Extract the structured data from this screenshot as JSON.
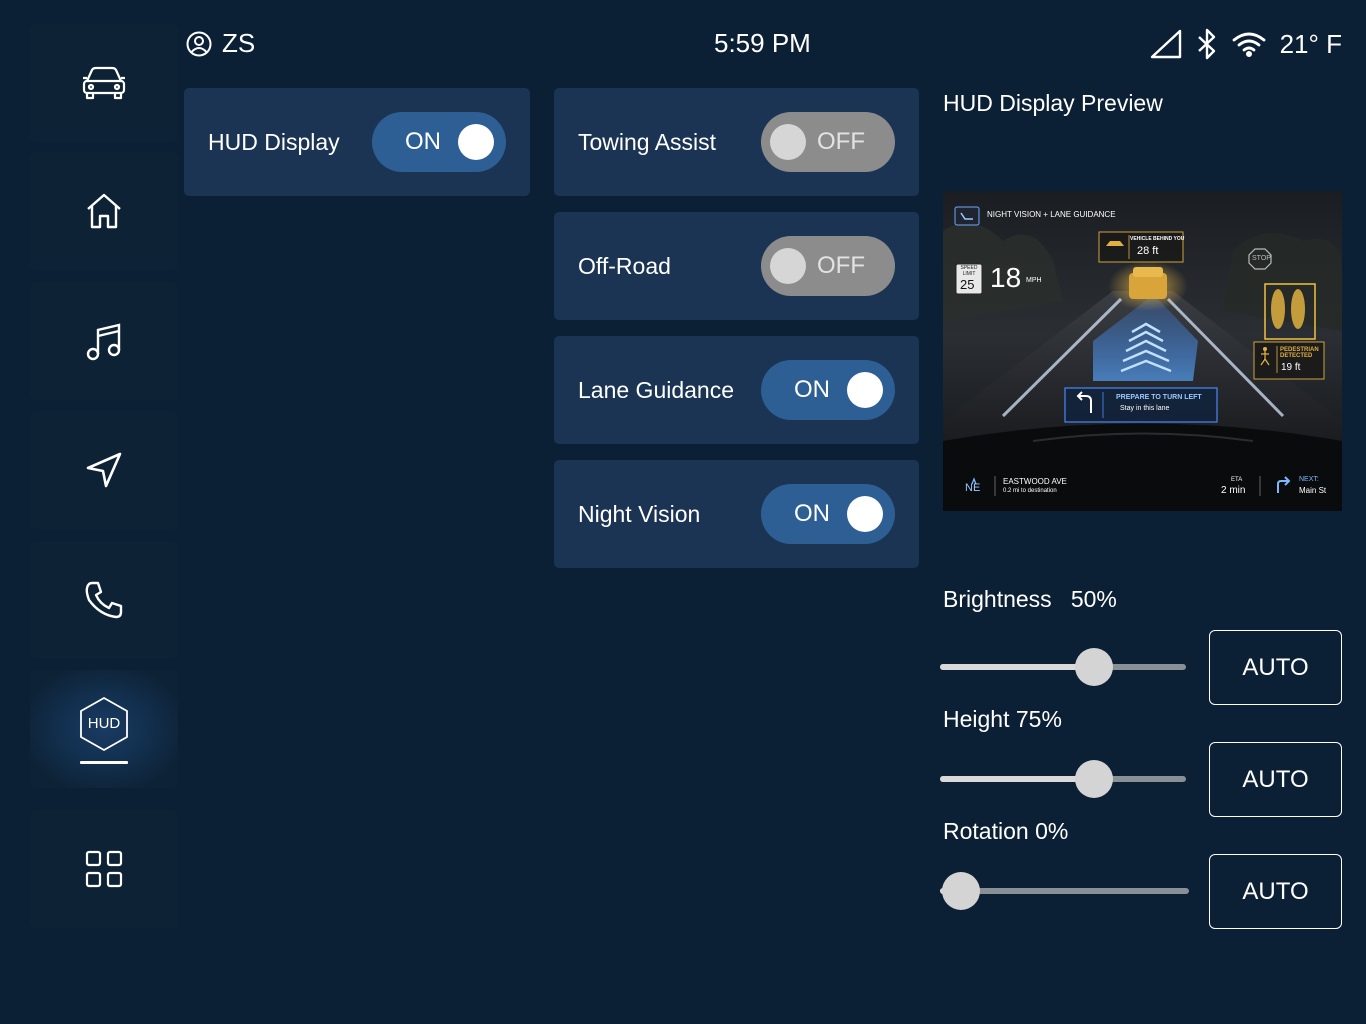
{
  "status_bar": {
    "user_initials": "ZS",
    "time": "5:59 PM",
    "temperature": "21° F"
  },
  "sidebar": {
    "items": [
      {
        "name": "car",
        "icon": "car-icon"
      },
      {
        "name": "home",
        "icon": "home-icon"
      },
      {
        "name": "music",
        "icon": "music-note-icon"
      },
      {
        "name": "navigation",
        "icon": "navigation-arrow-icon"
      },
      {
        "name": "phone",
        "icon": "phone-icon"
      },
      {
        "name": "hud",
        "icon": "hud-hexagon-icon",
        "label": "HUD",
        "active": true
      },
      {
        "name": "apps",
        "icon": "grid-icon"
      }
    ]
  },
  "toggles": {
    "hud_display": {
      "label": "HUD Display",
      "state": "ON"
    },
    "towing_assist": {
      "label": "Towing Assist",
      "state": "OFF"
    },
    "off_road": {
      "label": "Off-Road",
      "state": "OFF"
    },
    "lane_guidance": {
      "label": "Lane Guidance",
      "state": "ON"
    },
    "night_vision": {
      "label": "Night Vision",
      "state": "ON"
    }
  },
  "preview": {
    "title": "HUD Display Preview",
    "mode_label": "NIGHT VISION + LANE GUIDANCE",
    "vehicle_behind_label": "VEHICLE BEHIND YOU",
    "vehicle_behind_distance": "28 ft",
    "speed_limit_label": "SPEED LIMIT",
    "speed_limit": "25",
    "speed": "18",
    "speed_unit": "MPH",
    "stop_sign": "STOP",
    "pedestrian_label_1": "PEDESTRIAN",
    "pedestrian_label_2": "DETECTED",
    "pedestrian_distance": "19 ft",
    "turn_title": "PREPARE TO TURN LEFT",
    "turn_sub": "Stay in this lane",
    "heading": "NE",
    "street": "EASTWOOD AVE",
    "street_sub": "0.2 mi to destination",
    "eta_label": "ETA",
    "eta_value": "2 min",
    "next_label": "NEXT:",
    "next_street": "Main St"
  },
  "sliders": {
    "brightness": {
      "label": "Brightness",
      "value_text": "50%",
      "value": 0.65,
      "auto_label": "AUTO"
    },
    "height": {
      "label": "Height",
      "value_text": "75%",
      "value": 0.65,
      "auto_label": "AUTO"
    },
    "rotation": {
      "label": "Rotation",
      "value_text": "0%",
      "value": 0.0,
      "auto_label": "AUTO"
    }
  },
  "colors": {
    "background": "#0c2035",
    "card": "#1b3453",
    "toggle_on": "#2d5f95",
    "toggle_off": "#8c8c8c"
  }
}
